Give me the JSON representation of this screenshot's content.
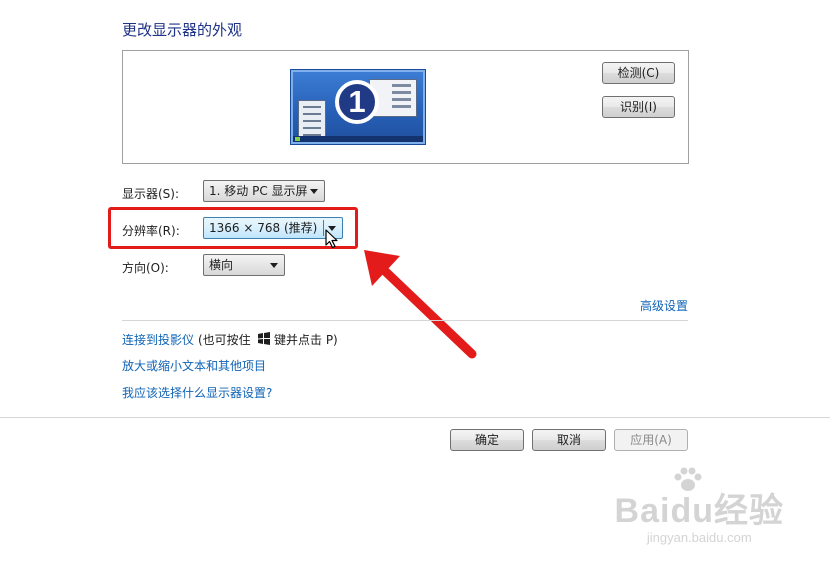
{
  "header": {
    "title": "更改显示器的外观"
  },
  "preview": {
    "monitor_number": "1",
    "detect_label": "检测(C)",
    "identify_label": "识别(I)"
  },
  "settings": {
    "display_label": "显示器(S):",
    "display_value": "1. 移动 PC 显示屏",
    "resolution_label": "分辨率(R):",
    "resolution_value": "1366 × 768 (推荐)",
    "orientation_label": "方向(O):",
    "orientation_value": "横向"
  },
  "advanced_link": "高级设置",
  "links": {
    "projector_link": "连接到投影仪",
    "projector_hint_before": "(也可按住",
    "projector_hint_after": "键并点击 P)",
    "text_size_link": "放大或缩小文本和其他项目",
    "help_link": "我应该选择什么显示器设置?"
  },
  "footer": {
    "ok_label": "确定",
    "cancel_label": "取消",
    "apply_label": "应用(A)"
  },
  "watermark": {
    "main": "Baidu经验",
    "sub": "jingyan.baidu.com"
  },
  "colors": {
    "title": "#1e3287",
    "link": "#0f63b6",
    "annotation": "#e31b1b"
  }
}
